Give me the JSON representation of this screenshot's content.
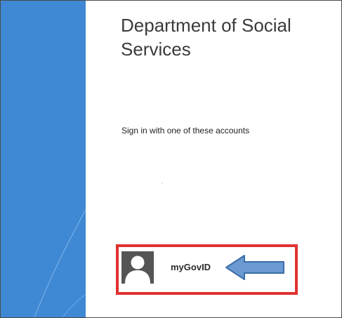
{
  "page": {
    "title_line1": "Department of Social",
    "title_line2": "Services",
    "signin_prompt": "Sign in with one of these accounts"
  },
  "accounts": [
    {
      "label": "myGovID",
      "icon": "user-avatar-icon"
    }
  ],
  "colors": {
    "side_panel": "#3f88d4",
    "highlight_border": "#e03131",
    "arrow_fill": "#6a9ad1",
    "arrow_stroke": "#3b6ea8",
    "avatar_bg": "#555555"
  }
}
